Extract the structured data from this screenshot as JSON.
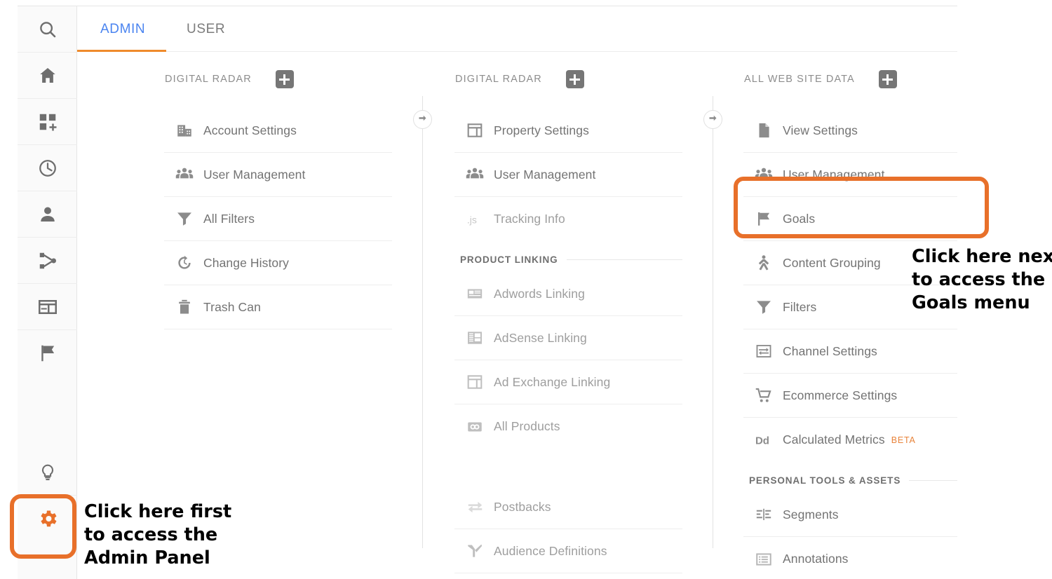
{
  "colors": {
    "accent_orange": "#e8702a",
    "tab_active_blue": "#4a84f0",
    "tab_underline_orange": "#ef8b2c",
    "icon_gray": "#757575",
    "text_gray": "#737373",
    "beta_orange": "#e8833a"
  },
  "rail": {
    "items": [
      {
        "icon": "search-icon"
      },
      {
        "icon": "home-icon"
      },
      {
        "icon": "customization-add-icon"
      },
      {
        "icon": "realtime-clock-icon"
      },
      {
        "icon": "audience-person-icon"
      },
      {
        "icon": "acquisition-share-icon"
      },
      {
        "icon": "behavior-window-icon"
      },
      {
        "icon": "conversions-flag-icon"
      }
    ],
    "bottom_items": [
      {
        "icon": "discover-bulb-icon"
      },
      {
        "icon": "admin-gear-icon"
      }
    ]
  },
  "tabs": {
    "admin": "ADMIN",
    "user": "USER"
  },
  "columns": [
    {
      "id": "account",
      "title": "DIGITAL RADAR",
      "add_label": "+",
      "groups": [
        {
          "heading": null,
          "items": [
            {
              "label": "Account Settings",
              "icon": "building-icon"
            },
            {
              "label": "User Management",
              "icon": "people-group-icon"
            },
            {
              "label": "All Filters",
              "icon": "funnel-icon"
            },
            {
              "label": "Change History",
              "icon": "history-clock-icon"
            },
            {
              "label": "Trash Can",
              "icon": "trash-icon"
            }
          ]
        }
      ]
    },
    {
      "id": "property",
      "title": "DIGITAL RADAR",
      "add_label": "+",
      "groups": [
        {
          "heading": null,
          "items": [
            {
              "label": "Property Settings",
              "icon": "layout-panel-icon"
            },
            {
              "label": "User Management",
              "icon": "people-group-icon"
            },
            {
              "label": "Tracking Info",
              "icon": "js-icon"
            }
          ]
        },
        {
          "heading": "PRODUCT LINKING",
          "items": [
            {
              "label": "Adwords Linking",
              "icon": "adwords-card-icon"
            },
            {
              "label": "AdSense Linking",
              "icon": "adsense-list-icon"
            },
            {
              "label": "Ad Exchange Linking",
              "icon": "layout-panel-icon"
            },
            {
              "label": "All Products",
              "icon": "all-products-link-icon"
            }
          ]
        },
        {
          "heading": "",
          "items": [
            {
              "label": "Postbacks",
              "icon": "postbacks-sync-icon"
            },
            {
              "label": "Audience Definitions",
              "icon": "audience-branch-icon"
            }
          ]
        }
      ]
    },
    {
      "id": "view",
      "title": "ALL WEB SITE DATA",
      "add_label": "+",
      "groups": [
        {
          "heading": null,
          "items": [
            {
              "label": "View Settings",
              "icon": "document-icon"
            },
            {
              "label": "User Management",
              "icon": "people-group-icon"
            },
            {
              "label": "Goals",
              "icon": "flag-icon",
              "highlighted": true
            },
            {
              "label": "Content Grouping",
              "icon": "content-grouping-icon"
            },
            {
              "label": "Filters",
              "icon": "funnel-icon"
            },
            {
              "label": "Channel Settings",
              "icon": "channel-settings-icon"
            },
            {
              "label": "Ecommerce Settings",
              "icon": "shopping-cart-icon"
            },
            {
              "label": "Calculated Metrics",
              "icon": "dd-icon",
              "badge": "BETA"
            }
          ]
        },
        {
          "heading": "PERSONAL TOOLS & ASSETS",
          "items": [
            {
              "label": "Segments",
              "icon": "segments-icon"
            },
            {
              "label": "Annotations",
              "icon": "annotations-icon"
            }
          ]
        }
      ]
    }
  ],
  "annotations": {
    "admin_note": [
      "Click here first",
      "to access the",
      "Admin Panel"
    ],
    "goals_note": [
      "Click here next",
      "to access the",
      "Goals menu"
    ]
  }
}
